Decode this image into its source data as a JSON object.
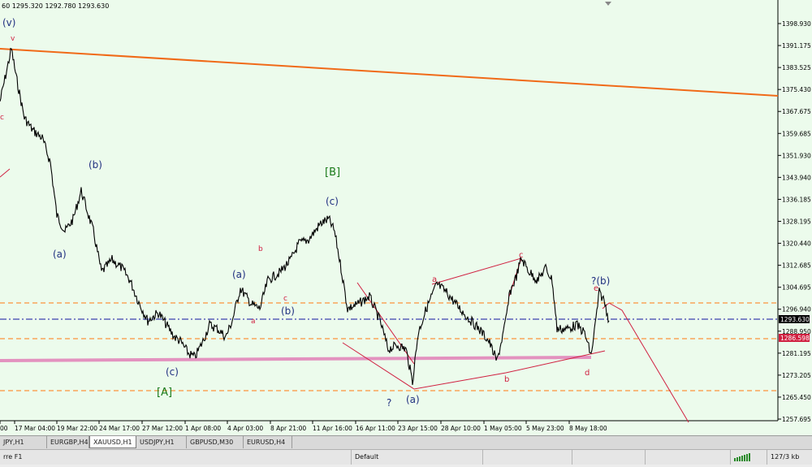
{
  "chart": {
    "ohlc_readout": "60 1295.320 1292.780 1293.630",
    "price_ticks": [
      "1398.930",
      "1391.175",
      "1383.525",
      "1375.430",
      "1367.675",
      "1359.685",
      "1351.930",
      "1343.940",
      "1336.185",
      "1328.195",
      "1320.440",
      "1312.685",
      "1304.695",
      "1296.940",
      "1288.950",
      "1281.195",
      "1273.205",
      "1265.450",
      "1257.695"
    ],
    "current_price_label": "1293.630",
    "alt_price_label": "1286.598",
    "time_ticks": [
      "00",
      "17 Mar 04:00",
      "19 Mar 22:00",
      "24 Mar 17:00",
      "27 Mar 12:00",
      "1 Apr 08:00",
      "4 Apr 03:00",
      "8 Apr 21:00",
      "11 Apr 16:00",
      "16 Apr 11:00",
      "23 Apr 15:00",
      "28 Apr 10:00",
      "1 May 05:00",
      "5 May 23:00",
      "8 May 18:00"
    ],
    "wave_labels": {
      "v_top": "(v)",
      "v_small": "v",
      "c_left": "c",
      "b_paren": "(b)",
      "a_paren_left": "(a)",
      "c_bottom": "(c)",
      "A_bracket": "[A]",
      "a_paren_mid": "(a)",
      "b_small": "b",
      "a_small": "a",
      "c_small": "c",
      "b_paren_mid": "(b)",
      "B_bracket": "[B]",
      "c_paren_top": "(c)",
      "question_low": "?",
      "a_paren_low": "(a)",
      "a_small_right": "a",
      "b_small_right": "b",
      "c_small_right": "c",
      "question_b": "?(b)",
      "e_small": "e",
      "d_small": "d"
    },
    "colors": {
      "background": "#ecfbec",
      "candles": "#000000",
      "trendline": "#f06a18",
      "support": "#e070b0",
      "wave_lines": "#d02040",
      "orange_dash": "#ff7a10",
      "blue_dash": "#1010a0"
    }
  },
  "tabs": [
    "JPY,H1",
    "EURGBP,H4",
    "XAUUSD,H1",
    "USDJPY,H1",
    "GBPUSD,M30",
    "EURUSD,H4"
  ],
  "active_tab_index": 2,
  "status": {
    "help": "rre F1",
    "profile": "Default",
    "traffic": "127/3 kb"
  }
}
